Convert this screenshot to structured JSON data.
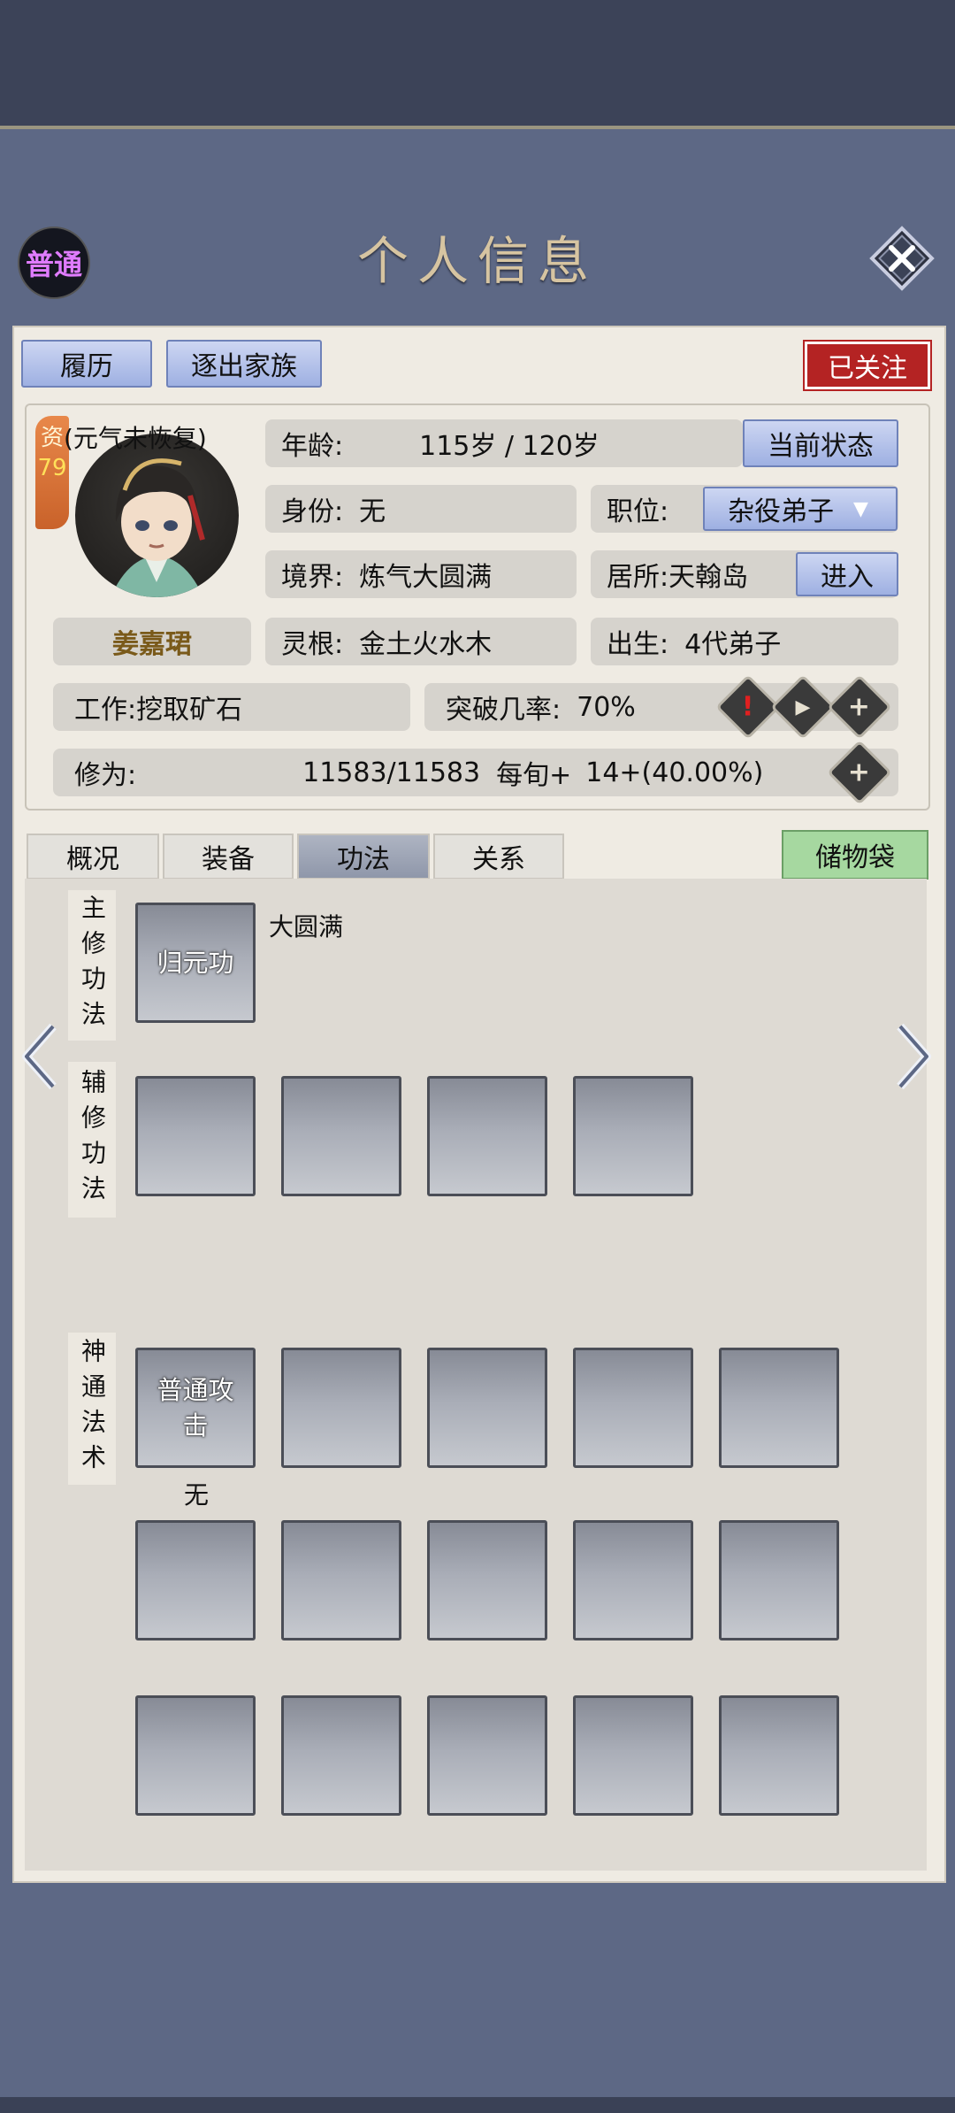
{
  "header": {
    "rank_badge": "普通",
    "title": "个人信息",
    "close_icon": "close-icon"
  },
  "top_buttons": {
    "history": "履历",
    "expel": "逐出家族",
    "followed": "已关注"
  },
  "profile": {
    "status_note": "(元气未恢复)",
    "aptitude_label": "资",
    "aptitude_value": "79",
    "name": "姜嘉珺",
    "age_label": "年龄:",
    "age_value": "115岁 / 120岁",
    "current_status_button": "当前状态",
    "identity_label": "身份:",
    "identity_value": "无",
    "position_label": "职位:",
    "position_value": "杂役弟子",
    "realm_label": "境界:",
    "realm_value": "炼气大圆满",
    "residence_label": "居所:",
    "residence_value": "天翰岛",
    "enter_button": "进入",
    "root_label": "灵根:",
    "root_value": "金土火水木",
    "birth_label": "出生:",
    "birth_value": "4代弟子",
    "work_label": "工作:",
    "work_value": "挖取矿石",
    "breakthrough_label": "突破几率:",
    "breakthrough_value": "70%",
    "cultivation_label": "修为:",
    "cultivation_value": "11583/11583",
    "per_period_label": "每旬+",
    "per_period_value": "14+(40.00%)"
  },
  "tabs": [
    {
      "label": "概况"
    },
    {
      "label": "装备"
    },
    {
      "label": "功法"
    },
    {
      "label": "关系"
    }
  ],
  "storage_bag": "储物袋",
  "skills": {
    "main_label": "主修功法",
    "main_slot": "归元功",
    "main_level": "大圆满",
    "aux_label": "辅修功法",
    "magic_label": "神通法术",
    "magic_slot": "普通攻击",
    "magic_level": "无"
  },
  "colors": {
    "accent_blue": "#9eb0e2",
    "followed_red": "#b42323",
    "storage_green": "#a6d8a0",
    "rank_purple": "#e07cff"
  }
}
